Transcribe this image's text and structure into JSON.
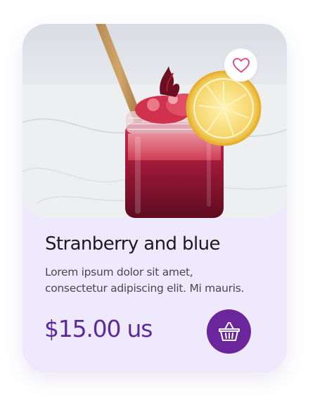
{
  "product": {
    "title": "Stranberry and blue",
    "description": "Lorem ipsum dolor sit amet, consectetur adipiscing elit. Mi mauris.",
    "price": "$15.00 us",
    "image_icon": "strawberry-drink-photo",
    "favorite_icon": "heart-outline-icon",
    "cart_icon": "basket-icon"
  },
  "colors": {
    "card_background": "#efe9fd",
    "accent": "#6a269a",
    "price_text": "#5b2a9b",
    "heart": "#d9437b"
  }
}
